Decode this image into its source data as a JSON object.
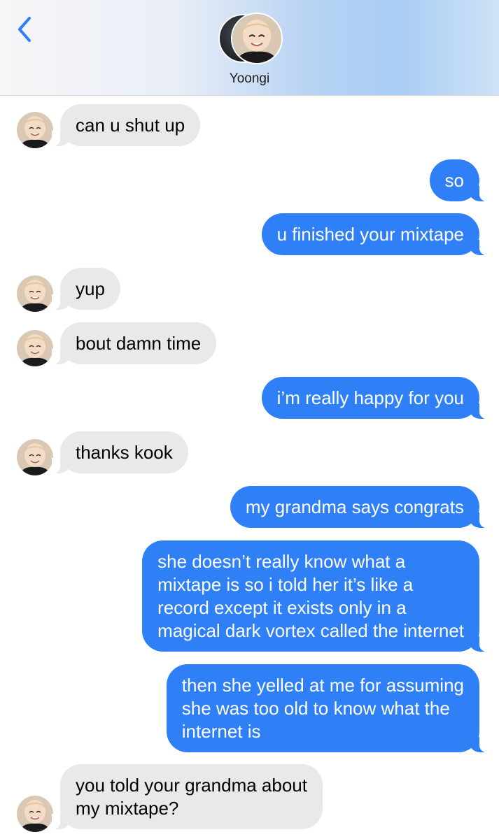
{
  "header": {
    "back_icon": "chevron-left-icon",
    "contact_name": "Yoongi",
    "accent_color": "#2f80f6"
  },
  "messages": [
    {
      "direction": "incoming",
      "text": "can u shut up"
    },
    {
      "direction": "outgoing",
      "text": "so"
    },
    {
      "direction": "outgoing",
      "text": "u finished your mixtape"
    },
    {
      "direction": "incoming",
      "text": "yup"
    },
    {
      "direction": "incoming",
      "text": "bout damn time"
    },
    {
      "direction": "outgoing",
      "text": "i’m really happy for you"
    },
    {
      "direction": "incoming",
      "text": "thanks kook"
    },
    {
      "direction": "outgoing",
      "text": "my grandma says congrats"
    },
    {
      "direction": "outgoing",
      "text": "she doesn’t really know what a\nmixtape is so i told her it’s like a\nrecord except it exists only in a\nmagical dark vortex called the internet"
    },
    {
      "direction": "outgoing",
      "text": "then she yelled at me for assuming\nshe was too old to know what the\ninternet is"
    },
    {
      "direction": "incoming",
      "text": "you told your grandma about\nmy mixtape?"
    }
  ],
  "colors": {
    "incoming_bubble": "#e9e9eb",
    "outgoing_bubble": "#2f80f6"
  }
}
